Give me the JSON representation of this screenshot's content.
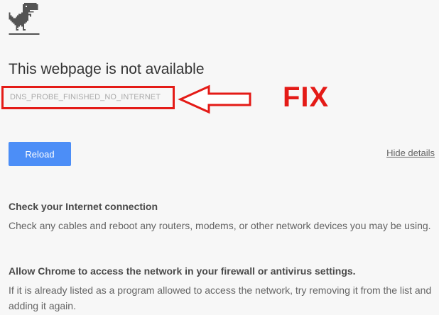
{
  "error_page": {
    "title": "This webpage is not available",
    "error_code": "DNS_PROBE_FINISHED_NO_INTERNET",
    "reload_label": "Reload",
    "hide_details_label": "Hide details",
    "dino_icon": "offline-dinosaur-icon"
  },
  "annotation": {
    "fix_label": "FIX",
    "color": "#e41b17"
  },
  "suggestions": [
    {
      "title": "Check your Internet connection",
      "body": "Check any cables and reboot any routers, modems, or other network devices you may be using."
    },
    {
      "title": "Allow Chrome to access the network in your firewall or antivirus settings.",
      "body": "If it is already listed as a program allowed to access the network, try removing it from the list and adding it again."
    }
  ],
  "colors": {
    "background": "#f7f7f7",
    "button": "#4c8ef7",
    "title_text": "#333333",
    "body_text": "#646464"
  }
}
